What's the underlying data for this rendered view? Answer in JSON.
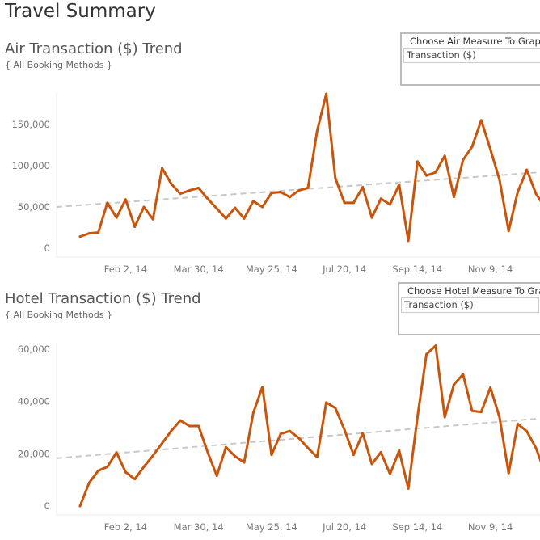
{
  "dashboard": {
    "title": "Travel Summary"
  },
  "colors": {
    "line": "#c9540a",
    "trend": "#c8c8c8",
    "axis": "#eeeeee",
    "tick_text": "#777777"
  },
  "air": {
    "title": "Air Transaction ($) Trend",
    "subtitle": "{ All Booking Methods }",
    "param_label": "Choose Air Measure To Graph",
    "param_value": "Transaction ($)"
  },
  "hotel": {
    "title": "Hotel Transaction ($) Trend",
    "subtitle": "{ All Booking Methods }",
    "param_label": "Choose Hotel Measure To Graph",
    "param_value": "Transaction ($)"
  },
  "chart_data": [
    {
      "type": "line",
      "x_start": "2013-12-29",
      "x_interval": "week",
      "x_tick_labels": [
        "Feb 2, 14",
        "Mar 30, 14",
        "May 25, 14",
        "Jul 20, 14",
        "Sep 14, 14",
        "Nov 9, 14"
      ],
      "x_tick_index": [
        5,
        13,
        21,
        29,
        37,
        45
      ],
      "y_tick_labels": [
        "0",
        "50,000",
        "100,000",
        "150,000"
      ],
      "y_ticks": [
        0,
        50000,
        100000,
        150000
      ],
      "ylim": [
        0,
        195000
      ],
      "values": [
        14000,
        18000,
        19000,
        55000,
        37000,
        59000,
        26000,
        50000,
        35000,
        97000,
        78000,
        66000,
        70000,
        73000,
        60000,
        48000,
        36000,
        49000,
        36000,
        57000,
        50000,
        67000,
        68000,
        62000,
        70000,
        73000,
        142000,
        187000,
        85000,
        55000,
        55000,
        74000,
        37000,
        60000,
        53000,
        77000,
        9000,
        105000,
        88000,
        92000,
        112000,
        62000,
        107000,
        123000,
        155000,
        120000,
        83000,
        21000,
        68000,
        95000,
        66000,
        49000
      ],
      "trend": {
        "type": "linear",
        "start_value": 50000,
        "end_value": 92000
      },
      "grid": false
    },
    {
      "type": "line",
      "x_start": "2013-12-29",
      "x_interval": "week",
      "x_tick_labels": [
        "Feb 2, 14",
        "Mar 30, 14",
        "May 25, 14",
        "Jul 20, 14",
        "Sep 14, 14",
        "Nov 9, 14"
      ],
      "x_tick_index": [
        5,
        13,
        21,
        29,
        37,
        45
      ],
      "y_tick_labels": [
        "0",
        "20,000",
        "40,000",
        "60,000"
      ],
      "y_ticks": [
        0,
        20000,
        40000,
        60000
      ],
      "ylim": [
        0,
        64000
      ],
      "values": [
        0,
        8900,
        13500,
        15000,
        20500,
        13000,
        10300,
        15000,
        19300,
        24000,
        28700,
        32700,
        30600,
        30600,
        20600,
        11600,
        22500,
        19000,
        16700,
        35600,
        45600,
        19600,
        27600,
        28700,
        26000,
        22200,
        18700,
        39600,
        37500,
        29200,
        19600,
        27900,
        16100,
        20600,
        12200,
        21200,
        6700,
        34000,
        58100,
        61300,
        34000,
        46500,
        50400,
        36400,
        36000,
        45300,
        34000,
        12600,
        31400,
        28600,
        22200,
        12600
      ],
      "trend": {
        "type": "linear",
        "start_value": 18300,
        "end_value": 33500
      },
      "grid": false
    }
  ]
}
